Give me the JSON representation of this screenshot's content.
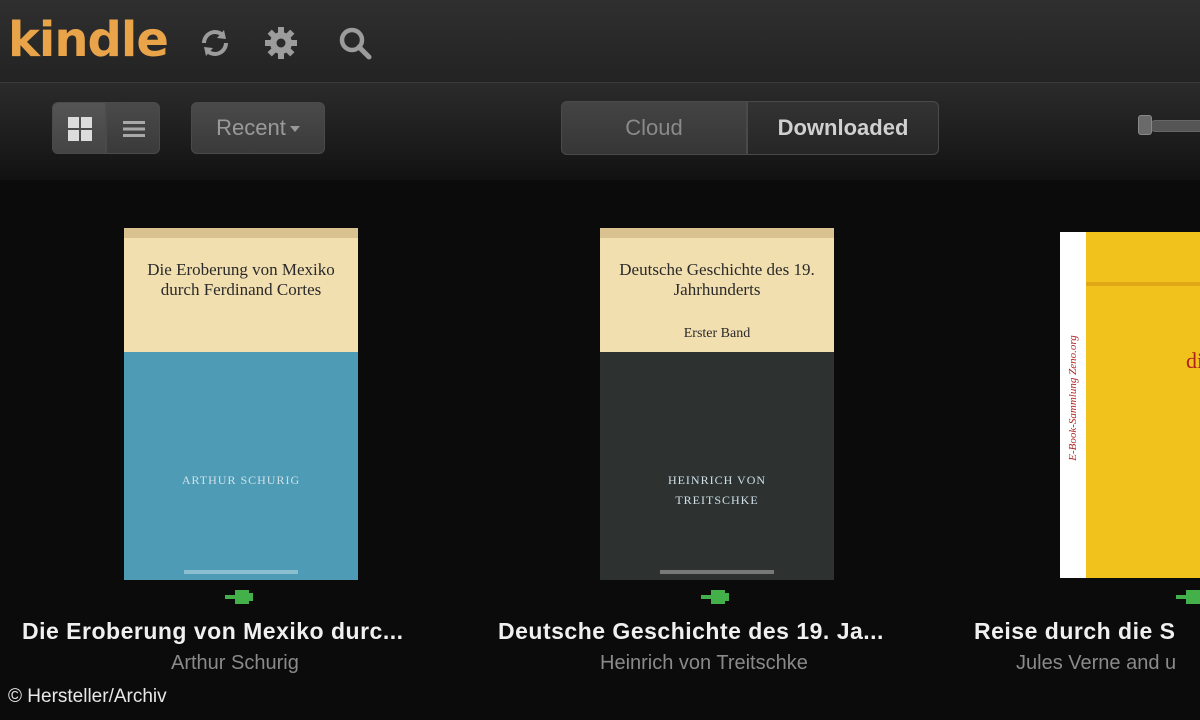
{
  "header": {
    "logo": "kindle",
    "icons": [
      "sync-icon",
      "settings-icon",
      "search-icon"
    ]
  },
  "toolbar": {
    "sort_label": "Recent",
    "segments": [
      {
        "label": "Cloud",
        "selected": false
      },
      {
        "label": "Downloaded",
        "selected": true
      }
    ]
  },
  "books": [
    {
      "cover_title": "Die Eroberung von Mexiko durch Ferdinand Cortes",
      "cover_author": "ARTHUR SCHURIG",
      "title": "Die Eroberung von Mexiko durc...",
      "author": "Arthur Schurig",
      "cover_color": "#4e9bb6"
    },
    {
      "cover_title": "Deutsche Geschichte des 19. Jahrhunderts",
      "cover_subtitle": "Erster Band",
      "cover_author": "HEINRICH VON TREITSCHKE",
      "title": "Deutsche Geschichte des 19. Ja...",
      "author": "Heinrich von Treitschke",
      "cover_color": "#2d3231"
    },
    {
      "cover_side_text": "E-Book-Sammlung Zeno.org",
      "cover_fragment": "di",
      "title": "Reise durch die S",
      "author": "Jules Verne and u",
      "cover_color": "#f2c21c"
    }
  ],
  "credit": "© Hersteller/Archiv",
  "colors": {
    "accent": "#e9a44a",
    "pin": "#43b04a"
  }
}
